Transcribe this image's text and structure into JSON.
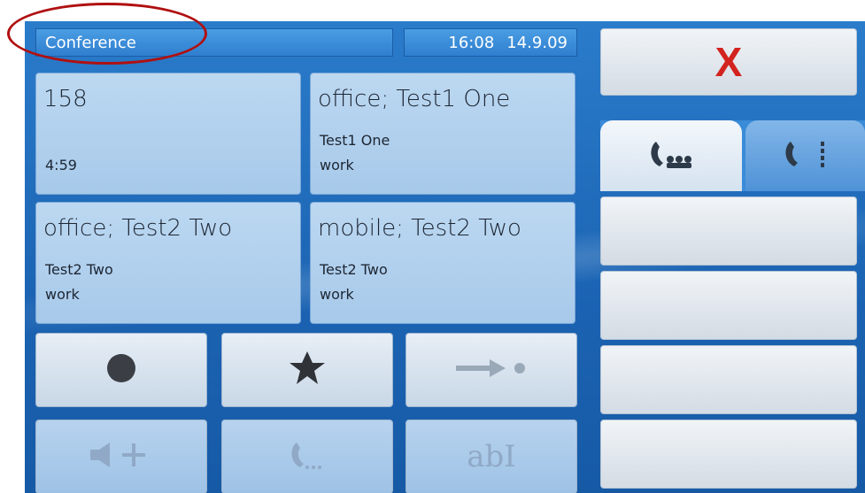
{
  "header": {
    "title": "Conference",
    "time": "16:08",
    "date": "14.9.09"
  },
  "calls": [
    {
      "line1": "158",
      "line2": "",
      "line3": "4:59"
    },
    {
      "line1": "office; Test1 One",
      "line2": "Test1 One",
      "line3": "work"
    },
    {
      "line1": "office; Test2 Two",
      "line2": "Test2 Two",
      "line3": "work"
    },
    {
      "line1": "mobile; Test2 Two",
      "line2": "Test2 Two",
      "line3": "work"
    }
  ],
  "buttons": {
    "row1": [
      "record-icon",
      "star-icon",
      "transfer-icon"
    ],
    "row2": [
      "speaker-plus-icon",
      "handset-dots-icon",
      "text-edit-icon"
    ],
    "row2_text": "abI"
  },
  "right": {
    "close_label": "X",
    "tabs": [
      "conference-handset-icon",
      "handset-list-icon"
    ],
    "empty_slots": 4
  },
  "colors": {
    "screen": "#1b63b2",
    "accent_red": "#d3231f",
    "annotation": "#b01010"
  }
}
